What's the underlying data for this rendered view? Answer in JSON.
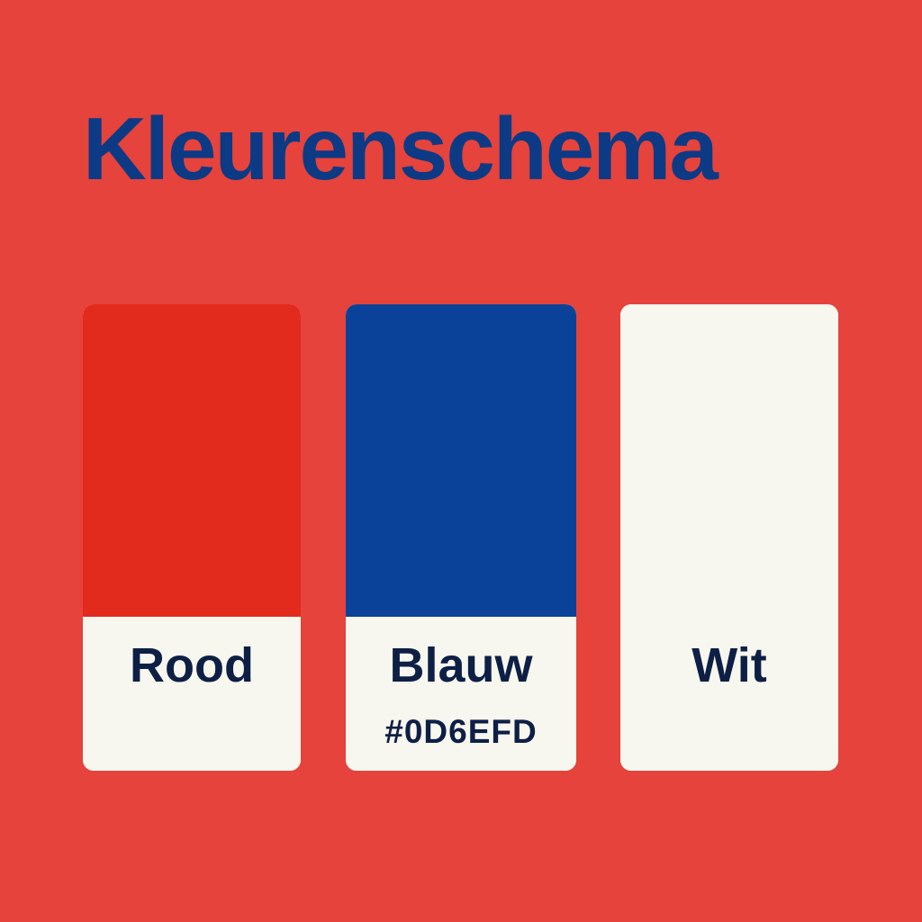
{
  "title": "Kleurenschema",
  "colors": {
    "background": "#e5433b",
    "title": "#0d3a85",
    "label_text": "#0d1f45",
    "card_base": "#f8f7ef"
  },
  "swatches": [
    {
      "label": "Rood",
      "color": "#e22a1d"
    },
    {
      "label": "Blauw",
      "color": "#0a4299",
      "hex": "#0D6EFD"
    },
    {
      "label": "Wit",
      "color": "#f8f7ef"
    }
  ]
}
